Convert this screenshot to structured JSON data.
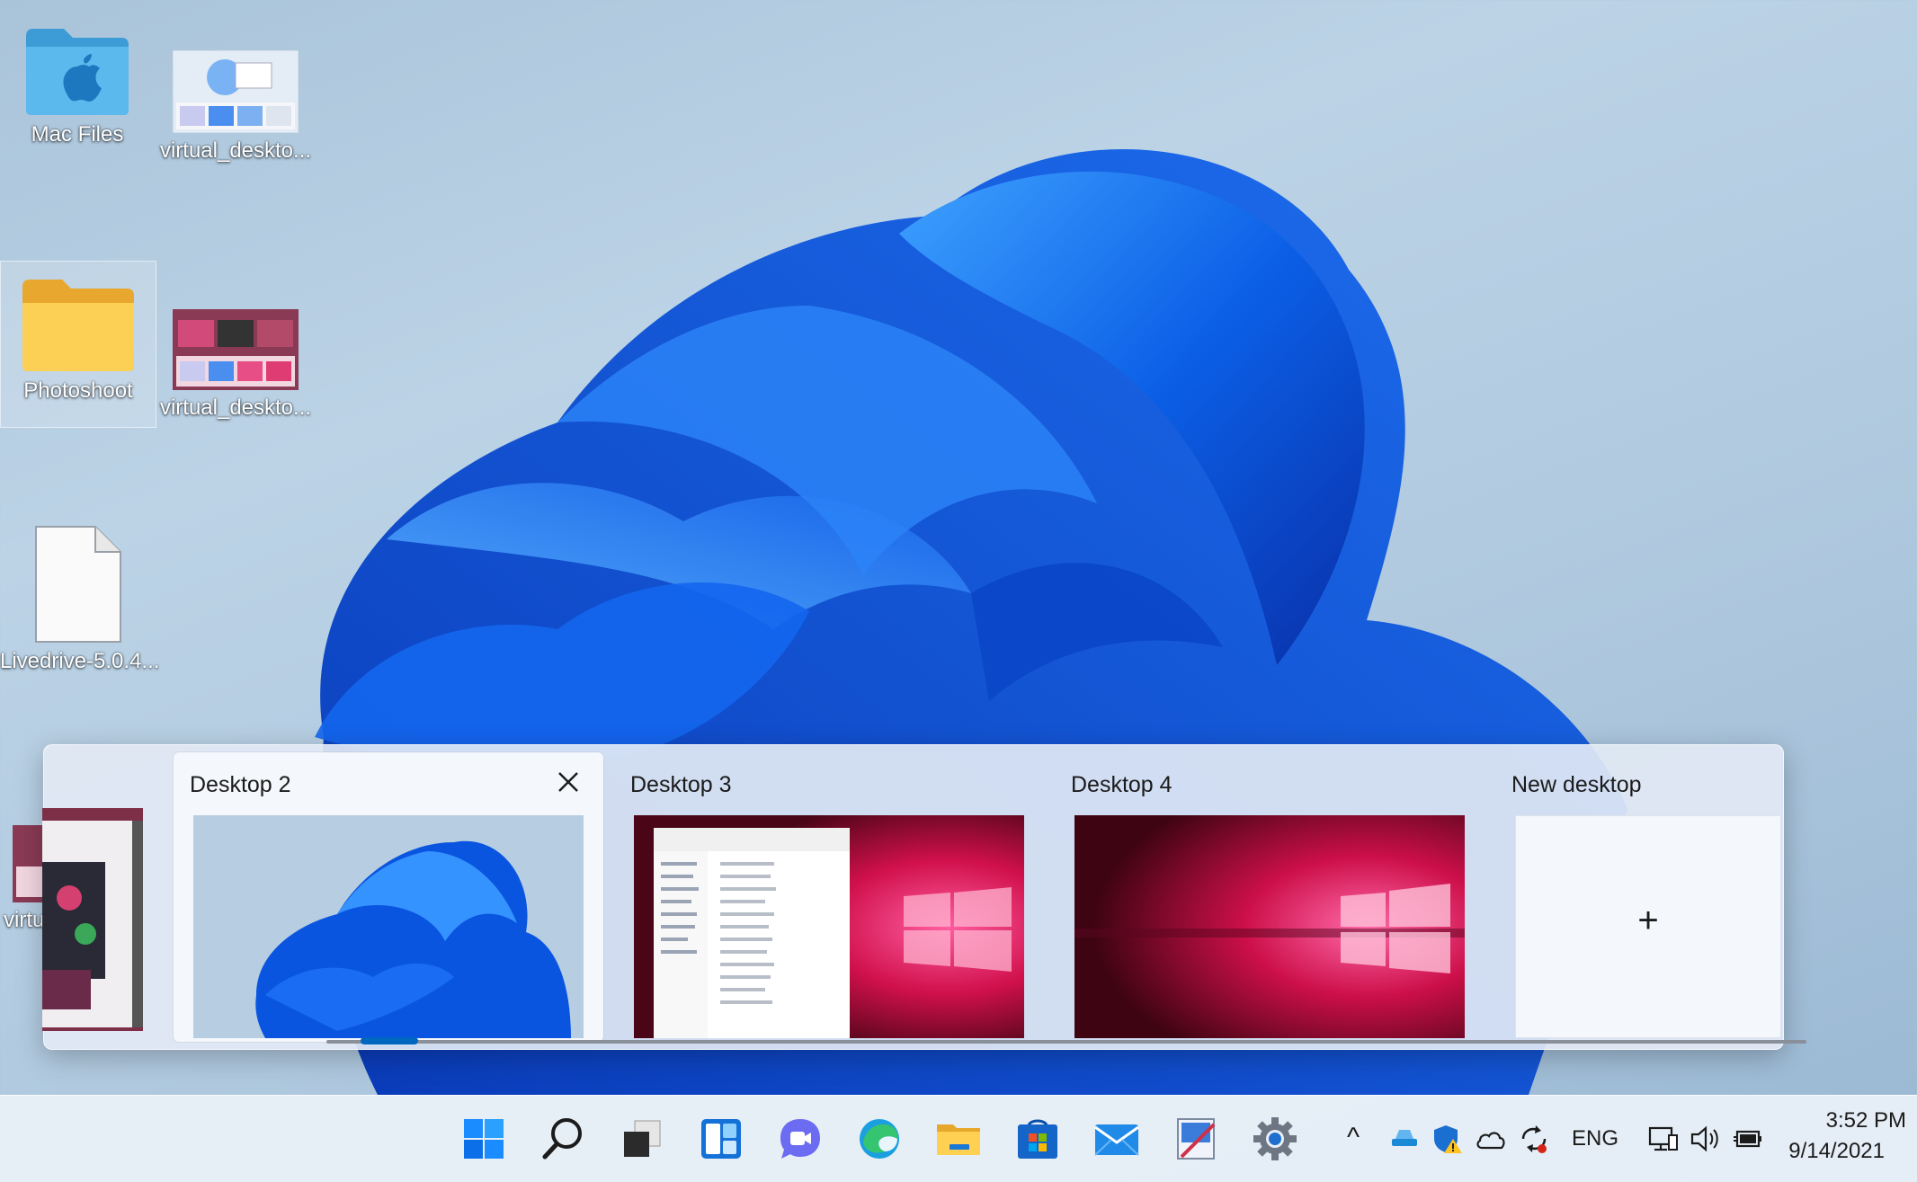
{
  "desktop": {
    "icons": [
      {
        "label": "Mac Files"
      },
      {
        "label": "virtual_deskto..."
      },
      {
        "label": "Photoshoot"
      },
      {
        "label": "virtual_deskto..."
      },
      {
        "label": "Livedrive-5.0.4..."
      },
      {
        "label": "virtu"
      }
    ]
  },
  "task_view": {
    "desktops": [
      {
        "label": "Desktop 2",
        "active": true
      },
      {
        "label": "Desktop 3"
      },
      {
        "label": "Desktop 4"
      }
    ],
    "new_desktop_label": "New desktop",
    "new_desktop_symbol": "+"
  },
  "taskbar": {
    "apps": [
      "start-icon",
      "search-icon",
      "task-view-icon",
      "widgets-icon",
      "chat-icon",
      "edge-icon",
      "file-explorer-icon",
      "store-icon",
      "mail-icon",
      "snipping-tool-icon",
      "settings-icon"
    ],
    "tray": {
      "chevron": "^",
      "language": "ENG",
      "time": "3:52 PM",
      "date": "9/14/2021"
    }
  },
  "colors": {
    "accent": "#0067c0",
    "bloom_blue": "#0a5ee8",
    "magenta": "#e8186a"
  }
}
